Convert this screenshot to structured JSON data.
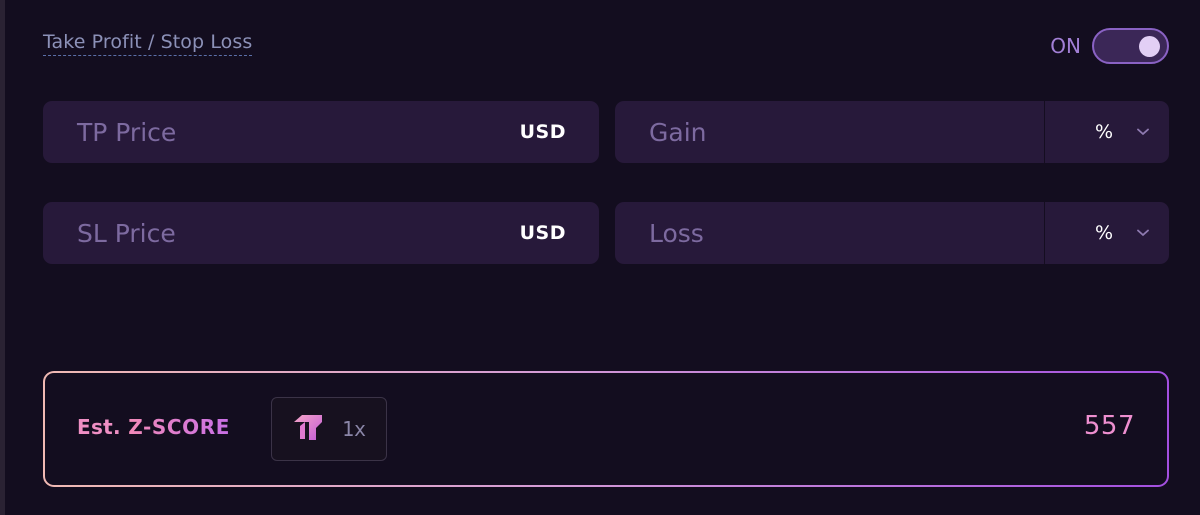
{
  "tpsl": {
    "label": "Take Profit / Stop Loss",
    "toggle_label": "ON",
    "toggle_on": true
  },
  "take_profit": {
    "price_placeholder": "TP Price",
    "price_unit": "USD",
    "gain_placeholder": "Gain",
    "gain_unit": "%"
  },
  "stop_loss": {
    "price_placeholder": "SL Price",
    "price_unit": "USD",
    "loss_placeholder": "Loss",
    "loss_unit": "%"
  },
  "zscore": {
    "prefix": "Est.",
    "brand": "Z-SCORE",
    "multiplier": "1x",
    "value": "557",
    "icon": "boost-arrow-icon"
  },
  "colors": {
    "background": "#130d1f",
    "field": "#27193a",
    "accent": "#a27fd6",
    "value": "#ee8fd0"
  }
}
